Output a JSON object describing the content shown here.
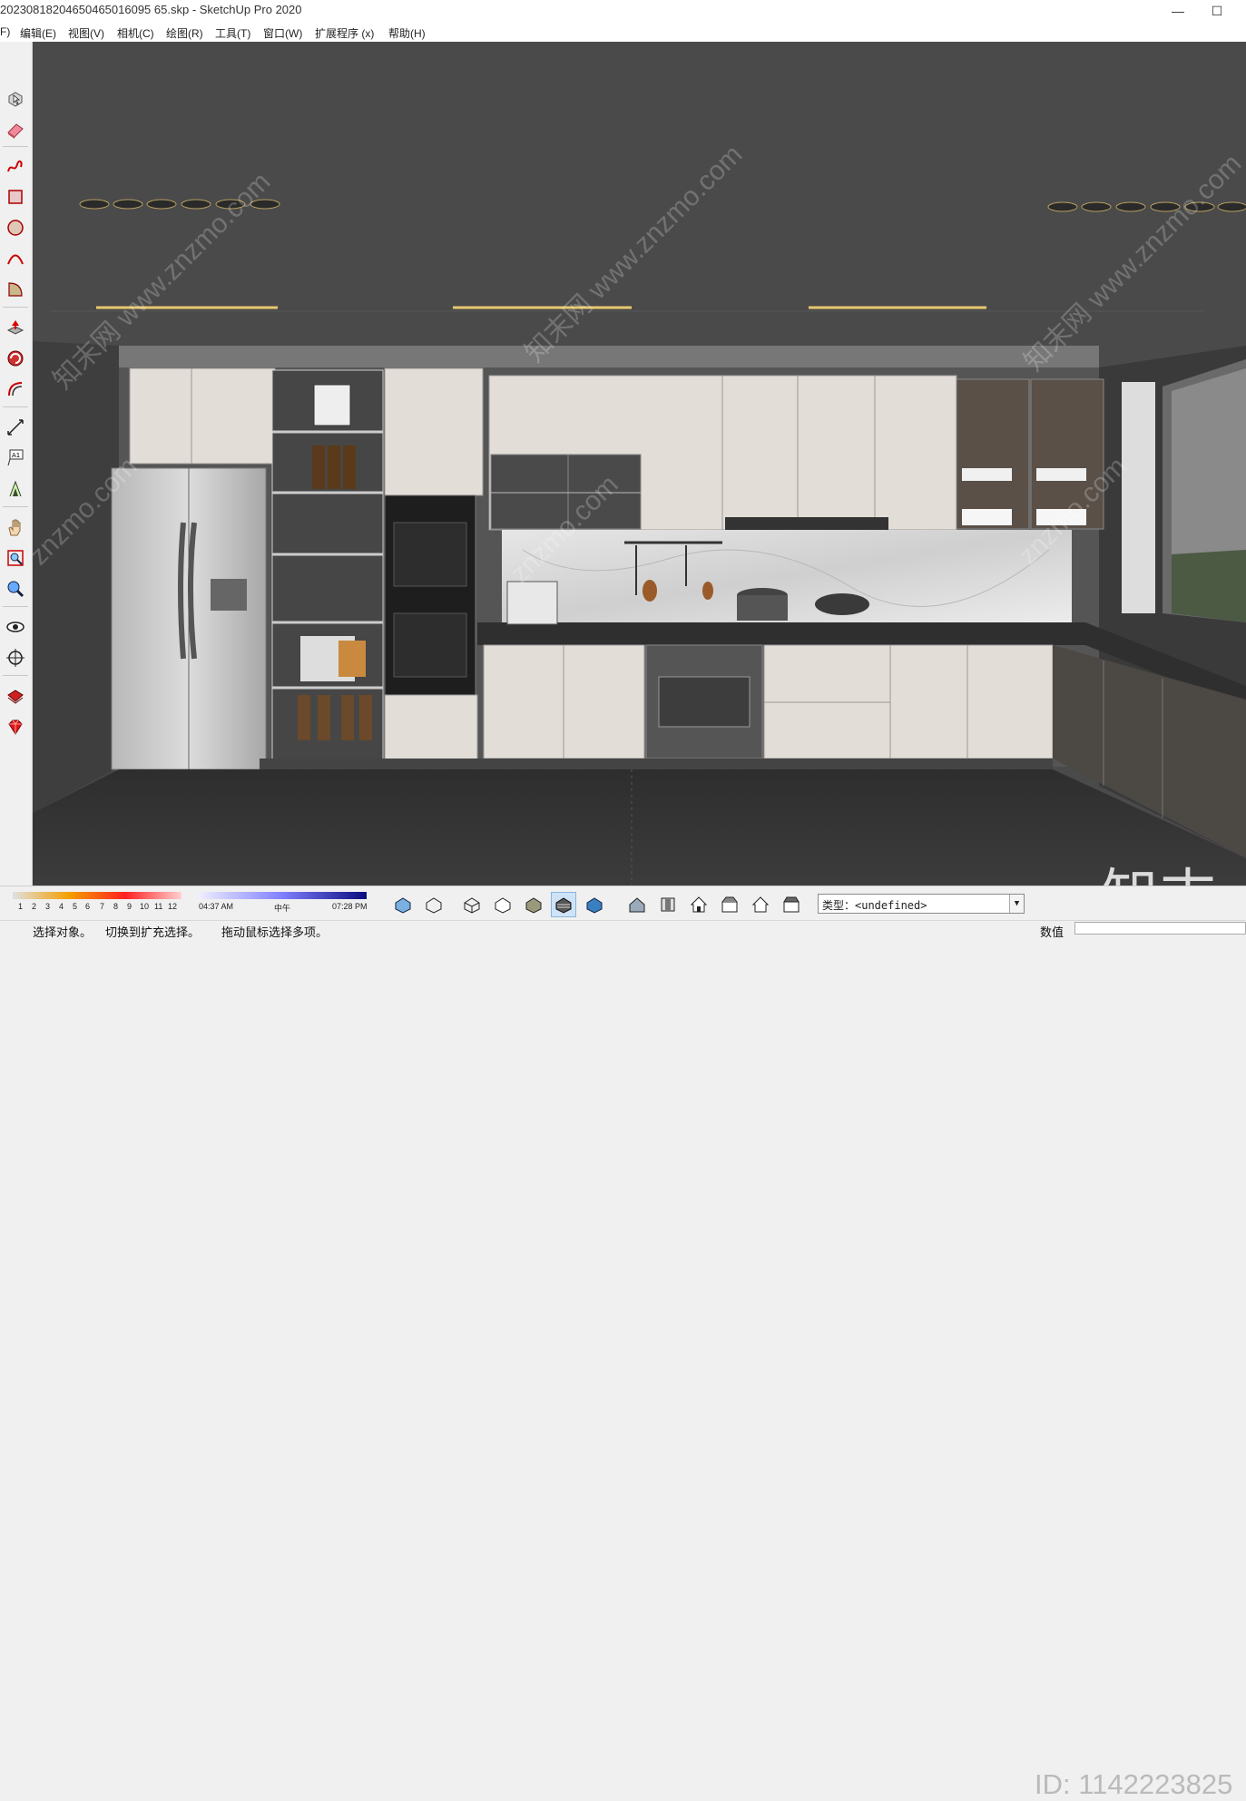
{
  "window": {
    "title": "20230818204650465016095 65.skp - SketchUp Pro 2020",
    "minimize_glyph": "—",
    "maximize_glyph": "☐"
  },
  "menu": [
    {
      "label": "F)"
    },
    {
      "label": "编辑(E)"
    },
    {
      "label": "视图(V)"
    },
    {
      "label": "相机(C)"
    },
    {
      "label": "绘图(R)"
    },
    {
      "label": "工具(T)"
    },
    {
      "label": "窗口(W)"
    },
    {
      "label": "扩展程序 (x)"
    },
    {
      "label": "帮助(H)"
    }
  ],
  "left_tools": [
    {
      "name": "select-icon"
    },
    {
      "name": "eraser-icon"
    },
    {
      "name": "freehand-icon"
    },
    {
      "name": "rectangle-icon"
    },
    {
      "name": "circle-icon"
    },
    {
      "name": "arc-icon"
    },
    {
      "name": "pie-icon"
    },
    {
      "name": "push-pull-icon"
    },
    {
      "name": "rotate-icon"
    },
    {
      "name": "offset-icon"
    },
    {
      "name": "dimension-icon"
    },
    {
      "name": "text-icon"
    },
    {
      "name": "protractor-icon"
    },
    {
      "name": "pan-icon"
    },
    {
      "name": "zoom-window-icon"
    },
    {
      "name": "zoom-icon"
    },
    {
      "name": "look-around-icon"
    },
    {
      "name": "position-camera-icon"
    },
    {
      "name": "extension-ruby-icon"
    },
    {
      "name": "extension-warehouse-icon"
    }
  ],
  "shadow": {
    "months": [
      "1",
      "2",
      "3",
      "4",
      "5",
      "6",
      "7",
      "8",
      "9",
      "10",
      "11",
      "12"
    ],
    "time_start": "04:37 AM",
    "time_mid": "中午",
    "time_end": "07:28 PM"
  },
  "style_select": {
    "value": "类型：<undefined>"
  },
  "status": {
    "hint_1": "选择对象。",
    "hint_2": "切换到扩充选择。",
    "hint_3": "拖动鼠标选择多项。",
    "measure_label": "数值"
  },
  "watermarks": {
    "site": "知末网 www.znzmo.com",
    "site_short": "znzmo.com",
    "brand": "知末",
    "id": "ID: 1142223825"
  }
}
